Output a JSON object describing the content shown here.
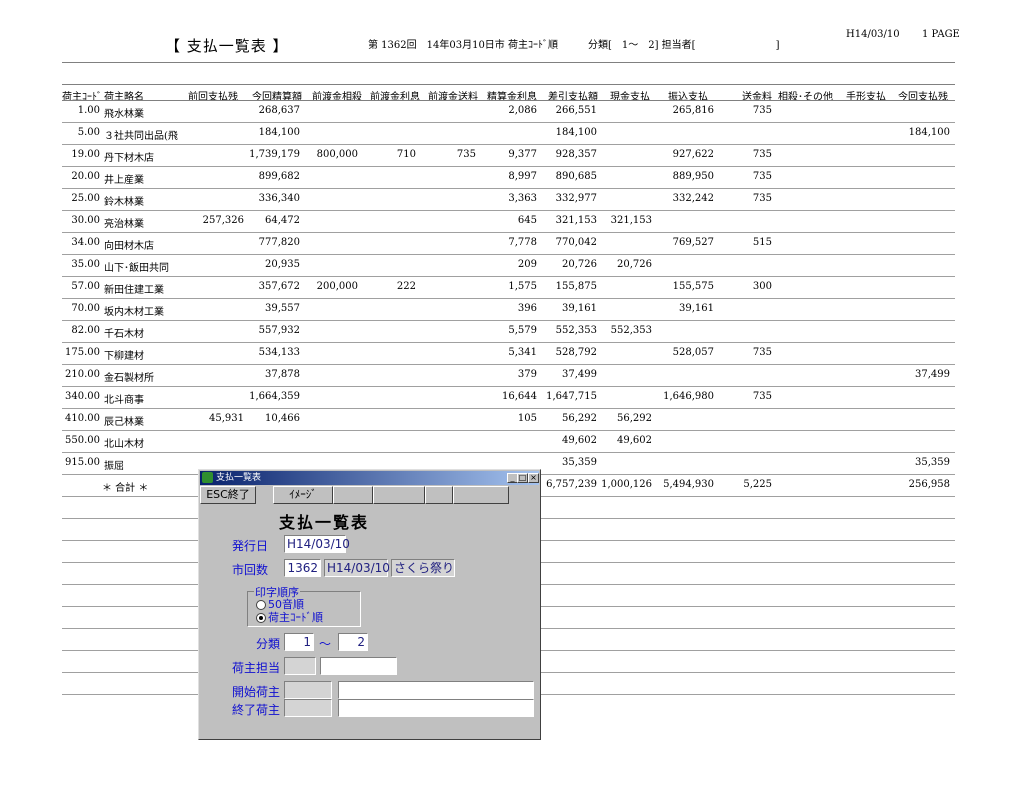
{
  "report": {
    "title": "【 支払一覧表 】",
    "info": "第 1362回　14年03月10日市 荷主ｺｰﾄﾞ順　　　分類[　1～　2] 担当者[　　　　　　　　]",
    "date": "H14/03/10",
    "page": "1 PAGE",
    "columns": [
      "荷主ｺｰﾄﾞ",
      "荷主略名",
      "前回支払残",
      "今回精算額",
      "前渡金相殺",
      "前渡金利息",
      "前渡金送料",
      "精算金利息",
      "差引支払額",
      "現金支払",
      "振込支払",
      "送金料",
      "相殺･その他",
      "手形支払",
      "今回支払残"
    ],
    "rows": [
      {
        "code": "1.00",
        "name": "飛水林業",
        "prev": "",
        "curr": "268,637",
        "adv": "",
        "advint": "",
        "advfee": "",
        "int": "2,086",
        "net": "266,551",
        "cash": "",
        "transfer": "265,816",
        "fee": "735",
        "offset": "",
        "bill": "",
        "bal": ""
      },
      {
        "code": "5.00",
        "name": "３社共同出品(飛",
        "prev": "",
        "curr": "184,100",
        "adv": "",
        "advint": "",
        "advfee": "",
        "int": "",
        "net": "184,100",
        "cash": "",
        "transfer": "",
        "fee": "",
        "offset": "",
        "bill": "",
        "bal": "184,100"
      },
      {
        "code": "19.00",
        "name": "丹下材木店",
        "prev": "",
        "curr": "1,739,179",
        "adv": "800,000",
        "advint": "710",
        "advfee": "735",
        "int": "9,377",
        "net": "928,357",
        "cash": "",
        "transfer": "927,622",
        "fee": "735",
        "offset": "",
        "bill": "",
        "bal": ""
      },
      {
        "code": "20.00",
        "name": "井上産業",
        "prev": "",
        "curr": "899,682",
        "adv": "",
        "advint": "",
        "advfee": "",
        "int": "8,997",
        "net": "890,685",
        "cash": "",
        "transfer": "889,950",
        "fee": "735",
        "offset": "",
        "bill": "",
        "bal": ""
      },
      {
        "code": "25.00",
        "name": "鈴木林業",
        "prev": "",
        "curr": "336,340",
        "adv": "",
        "advint": "",
        "advfee": "",
        "int": "3,363",
        "net": "332,977",
        "cash": "",
        "transfer": "332,242",
        "fee": "735",
        "offset": "",
        "bill": "",
        "bal": ""
      },
      {
        "code": "30.00",
        "name": "亮治林業",
        "prev": "257,326",
        "curr": "64,472",
        "adv": "",
        "advint": "",
        "advfee": "",
        "int": "645",
        "net": "321,153",
        "cash": "321,153",
        "transfer": "",
        "fee": "",
        "offset": "",
        "bill": "",
        "bal": ""
      },
      {
        "code": "34.00",
        "name": "向田材木店",
        "prev": "",
        "curr": "777,820",
        "adv": "",
        "advint": "",
        "advfee": "",
        "int": "7,778",
        "net": "770,042",
        "cash": "",
        "transfer": "769,527",
        "fee": "515",
        "offset": "",
        "bill": "",
        "bal": ""
      },
      {
        "code": "35.00",
        "name": "山下･飯田共同",
        "prev": "",
        "curr": "20,935",
        "adv": "",
        "advint": "",
        "advfee": "",
        "int": "209",
        "net": "20,726",
        "cash": "20,726",
        "transfer": "",
        "fee": "",
        "offset": "",
        "bill": "",
        "bal": ""
      },
      {
        "code": "57.00",
        "name": "新田住建工業",
        "prev": "",
        "curr": "357,672",
        "adv": "200,000",
        "advint": "222",
        "advfee": "",
        "int": "1,575",
        "net": "155,875",
        "cash": "",
        "transfer": "155,575",
        "fee": "300",
        "offset": "",
        "bill": "",
        "bal": ""
      },
      {
        "code": "70.00",
        "name": "坂内木材工業",
        "prev": "",
        "curr": "39,557",
        "adv": "",
        "advint": "",
        "advfee": "",
        "int": "396",
        "net": "39,161",
        "cash": "",
        "transfer": "39,161",
        "fee": "",
        "offset": "",
        "bill": "",
        "bal": ""
      },
      {
        "code": "82.00",
        "name": "千石木材",
        "prev": "",
        "curr": "557,932",
        "adv": "",
        "advint": "",
        "advfee": "",
        "int": "5,579",
        "net": "552,353",
        "cash": "552,353",
        "transfer": "",
        "fee": "",
        "offset": "",
        "bill": "",
        "bal": ""
      },
      {
        "code": "175.00",
        "name": "下柳建材",
        "prev": "",
        "curr": "534,133",
        "adv": "",
        "advint": "",
        "advfee": "",
        "int": "5,341",
        "net": "528,792",
        "cash": "",
        "transfer": "528,057",
        "fee": "735",
        "offset": "",
        "bill": "",
        "bal": ""
      },
      {
        "code": "210.00",
        "name": "金石製材所",
        "prev": "",
        "curr": "37,878",
        "adv": "",
        "advint": "",
        "advfee": "",
        "int": "379",
        "net": "37,499",
        "cash": "",
        "transfer": "",
        "fee": "",
        "offset": "",
        "bill": "",
        "bal": "37,499"
      },
      {
        "code": "340.00",
        "name": "北斗商事",
        "prev": "",
        "curr": "1,664,359",
        "adv": "",
        "advint": "",
        "advfee": "",
        "int": "16,644",
        "net": "1,647,715",
        "cash": "",
        "transfer": "1,646,980",
        "fee": "735",
        "offset": "",
        "bill": "",
        "bal": ""
      },
      {
        "code": "410.00",
        "name": "辰己林業",
        "prev": "45,931",
        "curr": "10,466",
        "adv": "",
        "advint": "",
        "advfee": "",
        "int": "105",
        "net": "56,292",
        "cash": "56,292",
        "transfer": "",
        "fee": "",
        "offset": "",
        "bill": "",
        "bal": ""
      },
      {
        "code": "550.00",
        "name": "北山木材",
        "prev": "",
        "curr": "",
        "adv": "",
        "advint": "",
        "advfee": "",
        "int": "",
        "net": "49,602",
        "cash": "49,602",
        "transfer": "",
        "fee": "",
        "offset": "",
        "bill": "",
        "bal": ""
      },
      {
        "code": "915.00",
        "name": "振屈",
        "prev": "",
        "curr": "",
        "adv": "",
        "advint": "",
        "advfee": "",
        "int": "",
        "net": "35,359",
        "cash": "",
        "transfer": "",
        "fee": "",
        "offset": "",
        "bill": "",
        "bal": "35,359"
      }
    ],
    "total": {
      "label": "＊ 合計 ＊",
      "net": "6,757,239",
      "cash": "1,000,126",
      "transfer": "5,494,930",
      "fee": "5,225",
      "bal": "256,958"
    }
  },
  "dialog": {
    "window_title": "支払一覧表",
    "buttons": {
      "min": "_",
      "max": "□",
      "close": "×"
    },
    "toolbar": {
      "esc": "ESC終了",
      "image": "ｲﾒｰｼﾞ"
    },
    "heading": "支払一覧表",
    "issue_date_label": "発行日",
    "issue_date": "H14/03/10",
    "market_no_label": "市回数",
    "market_no": "1362",
    "market_date": "H14/03/10",
    "market_name": "さくら祭り",
    "order_label": "印字順序",
    "order_options": [
      "50音順",
      "荷主ｺｰﾄﾞ順"
    ],
    "category_label": "分類",
    "category_from": "1",
    "category_tilde": "～",
    "category_to": "2",
    "owner_label": "荷主担当",
    "start_label": "開始荷主",
    "end_label": "終了荷主"
  }
}
